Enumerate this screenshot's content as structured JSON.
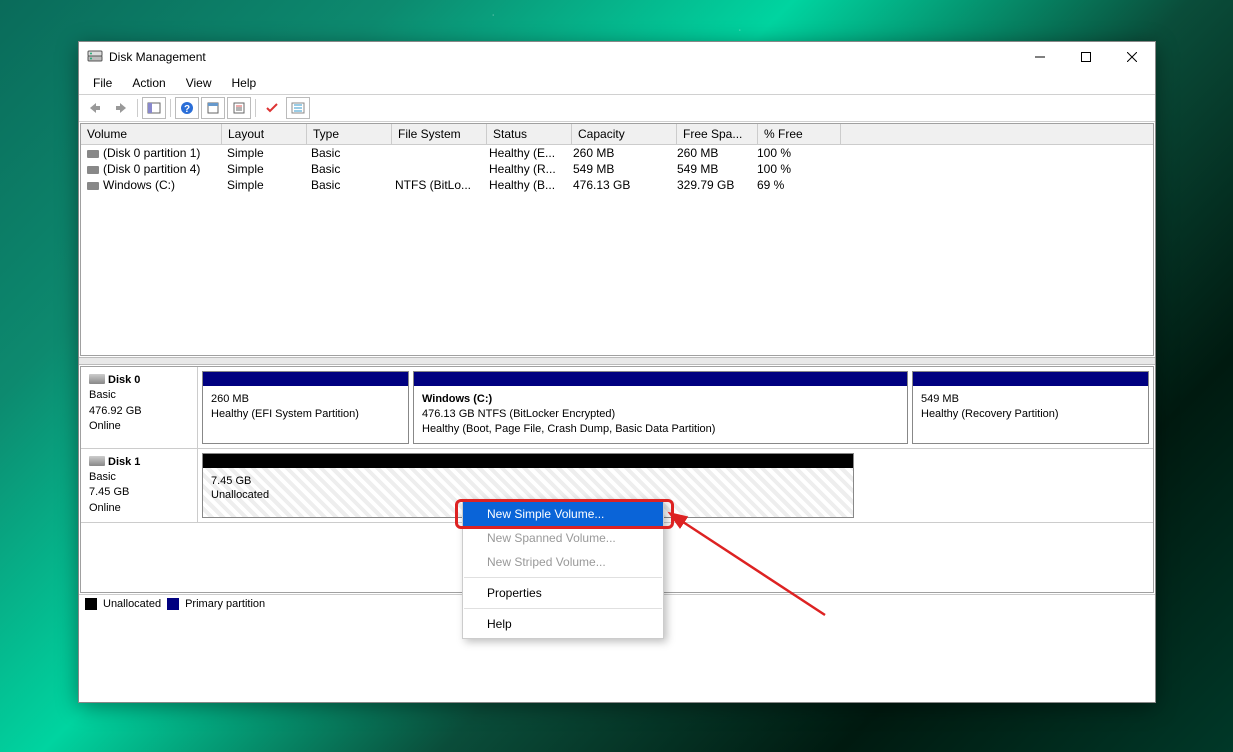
{
  "window": {
    "title": "Disk Management"
  },
  "menu": {
    "file": "File",
    "action": "Action",
    "view": "View",
    "help": "Help"
  },
  "toolbar_icons": {
    "back": "back-arrow-icon",
    "forward": "forward-arrow-icon",
    "show_hide": "show-hide-icon",
    "help": "help-icon",
    "refresh": "refresh-icon",
    "settings": "settings-icon",
    "check": "check-icon",
    "list": "list-icon"
  },
  "columns": {
    "volume": "Volume",
    "layout": "Layout",
    "type": "Type",
    "filesystem": "File System",
    "status": "Status",
    "capacity": "Capacity",
    "freespace": "Free Spa...",
    "pctfree": "% Free"
  },
  "volumes": [
    {
      "name": "(Disk 0 partition 1)",
      "layout": "Simple",
      "type": "Basic",
      "fs": "",
      "status": "Healthy (E...",
      "cap": "260 MB",
      "free": "260 MB",
      "pct": "100 %"
    },
    {
      "name": "(Disk 0 partition 4)",
      "layout": "Simple",
      "type": "Basic",
      "fs": "",
      "status": "Healthy (R...",
      "cap": "549 MB",
      "free": "549 MB",
      "pct": "100 %"
    },
    {
      "name": "Windows (C:)",
      "layout": "Simple",
      "type": "Basic",
      "fs": "NTFS (BitLo...",
      "status": "Healthy (B...",
      "cap": "476.13 GB",
      "free": "329.79 GB",
      "pct": "69 %"
    }
  ],
  "disks": [
    {
      "name": "Disk 0",
      "type": "Basic",
      "size": "476.92 GB",
      "state": "Online",
      "partitions": [
        {
          "bar": "navy",
          "title": "",
          "line2": "260 MB",
          "line3": "Healthy (EFI System Partition)",
          "flex": "0 0 205px"
        },
        {
          "bar": "navy",
          "title": "Windows  (C:)",
          "line2": "476.13 GB NTFS (BitLocker Encrypted)",
          "line3": "Healthy (Boot, Page File, Crash Dump, Basic Data Partition)",
          "flex": "1 1 auto"
        },
        {
          "bar": "navy",
          "title": "",
          "line2": "549 MB",
          "line3": "Healthy (Recovery Partition)",
          "flex": "0 0 235px"
        }
      ]
    },
    {
      "name": "Disk 1",
      "type": "Basic",
      "size": "7.45 GB",
      "state": "Online",
      "partitions": [
        {
          "bar": "black",
          "title": "",
          "line2": "7.45 GB",
          "line3": "Unallocated",
          "flex": "0 0 650px",
          "patterned": true
        }
      ]
    }
  ],
  "legend": {
    "unallocated": "Unallocated",
    "primary": "Primary partition"
  },
  "context_menu": {
    "items": [
      {
        "label": "New Simple Volume...",
        "state": "selected"
      },
      {
        "label": "New Spanned Volume...",
        "state": "disabled"
      },
      {
        "label": "New Striped Volume...",
        "state": "disabled"
      },
      {
        "sep": true
      },
      {
        "label": "Properties",
        "state": "normal"
      },
      {
        "sep": true
      },
      {
        "label": "Help",
        "state": "normal"
      }
    ]
  }
}
